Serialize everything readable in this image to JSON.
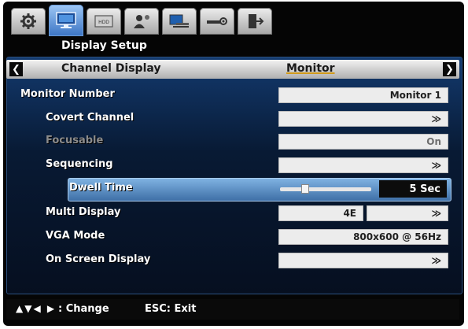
{
  "tabs": [
    {
      "icon": "gear-icon"
    },
    {
      "icon": "monitor-icon",
      "active": true
    },
    {
      "icon": "hdd-icon",
      "label": "HDD"
    },
    {
      "icon": "user-icon"
    },
    {
      "icon": "network-icon"
    },
    {
      "icon": "system-settings-icon"
    },
    {
      "icon": "exit-icon"
    }
  ],
  "header": {
    "title": "Display Setup"
  },
  "subbar": {
    "left_label": "Channel Display",
    "right_label": "Monitor"
  },
  "rows": {
    "monitor_number": {
      "label": "Monitor Number",
      "value": "Monitor 1"
    },
    "covert_channel": {
      "label": "Covert Channel",
      "value": "≫"
    },
    "focusable": {
      "label": "Focusable",
      "value": "On"
    },
    "sequencing": {
      "label": "Sequencing",
      "value": "≫"
    },
    "dwell_time": {
      "label": "Dwell Time",
      "value": "5 Sec",
      "slider_level": 0.25
    },
    "multi_display": {
      "label": "Multi Display",
      "value": "4E",
      "value2": "≫"
    },
    "vga_mode": {
      "label": "VGA Mode",
      "value": "800x600 @ 56Hz"
    },
    "on_screen_display": {
      "label": "On Screen Display",
      "value": "≫"
    }
  },
  "footer": {
    "arrows": "▲▼◀ ▶",
    "change": ": Change",
    "esc": "ESC: Exit"
  }
}
